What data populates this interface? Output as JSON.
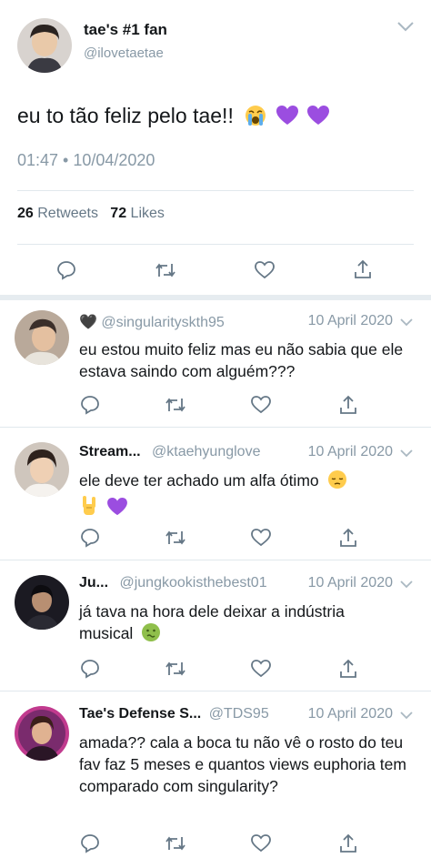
{
  "main_tweet": {
    "display_name": "tae's #1 fan",
    "handle": "@ilovetaetae",
    "text": "eu to tão feliz pelo tae!!",
    "emojis": [
      "loudly-crying-face",
      "purple-heart",
      "purple-heart"
    ],
    "timestamp": "01:47 • 10/04/2020",
    "retweets_count": "26",
    "retweets_label": "Retweets",
    "likes_count": "72",
    "likes_label": "Likes"
  },
  "replies": [
    {
      "display_name": "🖤",
      "handle": "@singularityskth95",
      "date": "10 April 2020",
      "text": "eu estou muito feliz mas eu não sabia que ele estava saindo com alguém???"
    },
    {
      "display_name": "Stream...",
      "handle": "@ktaehyunglove",
      "date": "10 April 2020",
      "text": "ele deve ter achado um alfa ótimo",
      "emojis": [
        "pensive-face",
        "sign-of-horns",
        "purple-heart"
      ]
    },
    {
      "display_name": "Ju...",
      "handle": "@jungkookisthebest01",
      "date": "10 April 2020",
      "text": "já tava na hora dele deixar a indústria musical",
      "emojis": [
        "nauseated-face"
      ]
    },
    {
      "display_name": "Tae's Defense S...",
      "handle": "@TDS95",
      "date": "10 April 2020",
      "text": "amada?? cala a boca tu não vê o rosto do teu fav faz 5 meses e quantos views euphoria tem comparado com singularity?"
    }
  ],
  "colors": {
    "accent": "#657786",
    "muted": "#8899a6",
    "text": "#14171a",
    "divider": "#e1e8ed",
    "purple_heart": "#9b4de0"
  },
  "icons": [
    "reply-icon",
    "retweet-icon",
    "like-icon",
    "share-icon",
    "chevron-down-icon"
  ]
}
